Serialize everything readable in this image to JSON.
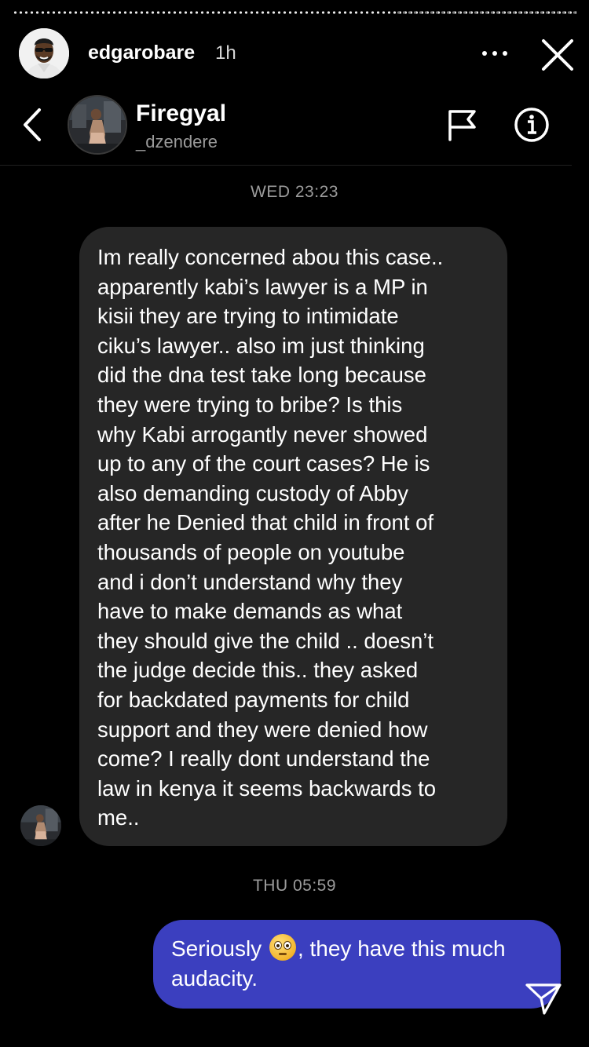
{
  "story": {
    "username": "edgarobare",
    "time": "1h",
    "progress_complete": 0.68
  },
  "chat": {
    "name": "Firegyal",
    "handle": "_dzendere"
  },
  "messages": [
    {
      "timestamp": "WED 23:23",
      "direction": "incoming",
      "text": "Im really concerned abou this case..\napparently kabi’s lawyer is a MP in\nkisii they are trying to intimidate\nciku’s lawyer.. also im just thinking\ndid the dna test take long because\nthey were trying to bribe? Is this\nwhy Kabi arrogantly never showed\nup to any of the court cases? He is\nalso demanding custody of Abby\nafter he Denied that child in front  of\nthousands of people on youtube\nand i don’t understand why they\nhave to make demands as what\nthey should give the child .. doesn’t\nthe judge decide this.. they asked\nfor backdated payments for child\nsupport and they were denied how\ncome? I really dont understand the\nlaw in kenya it seems backwards to\nme.."
    },
    {
      "timestamp": "THU 05:59",
      "direction": "outgoing",
      "text_before_emoji": "Seriously ",
      "emoji": "flushed-face",
      "text_after_emoji": ", they have this much audacity."
    }
  ],
  "icons": {
    "more": "more-horizontal-icon",
    "close": "close-icon",
    "back": "chevron-left-icon",
    "report": "flag-icon",
    "info": "info-icon",
    "send": "send-icon"
  },
  "colors": {
    "background": "#000000",
    "incoming_bubble": "#262626",
    "outgoing_bubble": "#3b3fbf",
    "timestamp": "#9c9c9c",
    "handle": "#9a9a9a"
  }
}
